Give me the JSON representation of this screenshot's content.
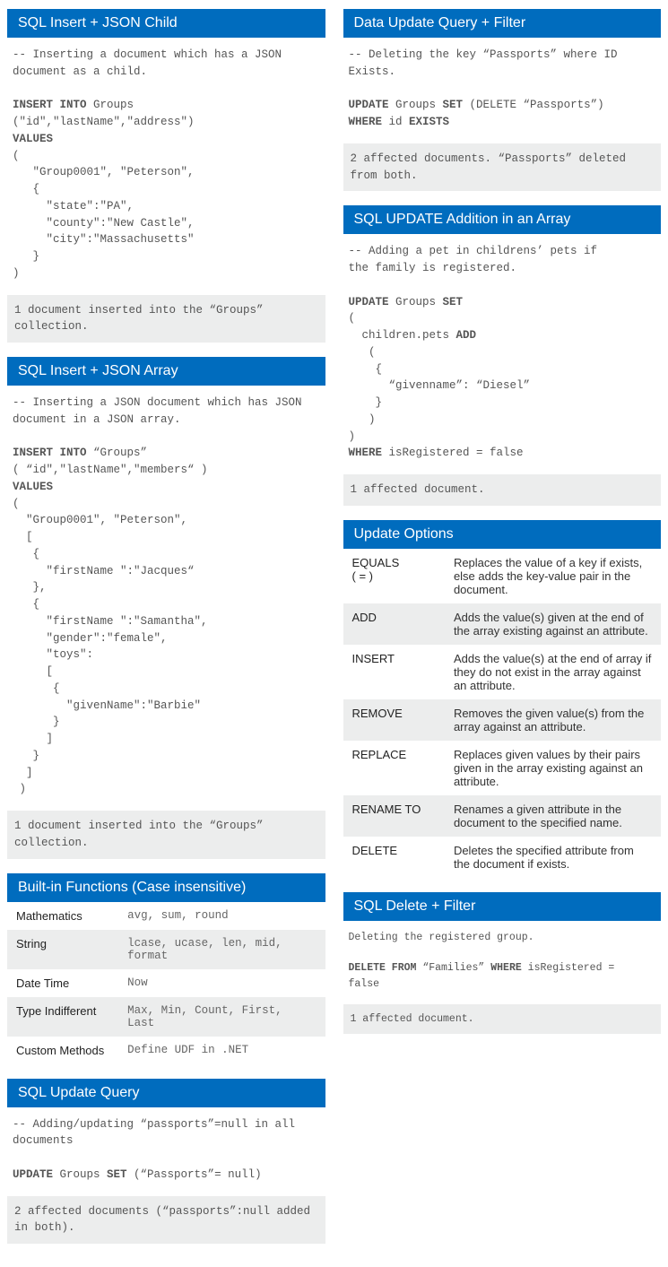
{
  "left": {
    "insert_child": {
      "title": "SQL Insert + JSON Child",
      "code": "-- Inserting a document which has a JSON\ndocument as a child.\n\n<b>INSERT INTO</b> Groups\n(\"id\",\"lastName\",\"address\")\n<b>VALUES</b>\n(\n   \"Group0001\", \"Peterson\",\n   {\n     \"state\":\"PA\",\n     \"county\":\"New Castle\",\n     \"city\":\"Massachusetts\"\n   }\n)",
      "result": "1 document inserted into the “Groups”\ncollection."
    },
    "insert_array": {
      "title": "SQL Insert + JSON Array",
      "code": "-- Inserting a JSON document which has JSON\ndocument in a JSON array.\n\n<b>INSERT INTO</b> “Groups”\n( “id\",\"lastName\",\"members“ )\n<b>VALUES</b>\n(\n  \"Group0001\", \"Peterson\",\n  [\n   {\n     \"firstName \":\"Jacques“\n   },\n   {\n     \"firstName \":\"Samantha\",\n     \"gender\":\"female\",\n     \"toys\":\n     [\n      {\n        \"givenName\":\"Barbie\"\n      }\n     ]\n   }\n  ]\n )",
      "result": "1 document inserted into the “Groups”\ncollection."
    },
    "builtins": {
      "title": "Built-in Functions (Case insensitive)",
      "rows": [
        {
          "label": "Mathematics",
          "value": "avg, sum, round"
        },
        {
          "label": "String",
          "value": "lcase, ucase, len, mid,\nformat"
        },
        {
          "label": "Date Time",
          "value": "Now"
        },
        {
          "label": "Type Indifferent",
          "value": "Max, Min, Count, First,\nLast"
        },
        {
          "label": "Custom Methods",
          "value": "Define UDF in .NET"
        }
      ]
    },
    "update_query": {
      "title": "SQL Update Query",
      "code": "-- Adding/updating “passports”=null in all\ndocuments\n\n<b>UPDATE</b> Groups <b>SET</b> (“Passports”= null)",
      "result": "2 affected documents (“passports”:null added\nin both)."
    }
  },
  "right": {
    "update_filter": {
      "title": "Data Update Query + Filter",
      "code": "-- Deleting the key “Passports” where ID\nExists.\n\n<b>UPDATE</b> Groups <b>SET</b> (DELETE “Passports”)\n<b>WHERE</b> id <b>EXISTS</b>",
      "result": "2 affected documents. “Passports” deleted\nfrom both."
    },
    "update_addition": {
      "title": "SQL UPDATE Addition in an Array",
      "code": "-- Adding a pet in childrens’ pets if\nthe family is registered.\n\n<b>UPDATE</b> Groups <b>SET</b>\n(\n  children.pets <b>ADD</b>\n   (\n    {\n      “givenname”: “Diesel”\n    }\n   )\n)\n<b>WHERE</b> isRegistered = false",
      "result": "1 affected document."
    },
    "update_options": {
      "title": "Update Options",
      "rows": [
        {
          "key": "EQUALS\n( = )",
          "desc": "Replaces the value of a key if exists, else adds the key-value pair in the document."
        },
        {
          "key": "ADD",
          "desc": "Adds the value(s) given at the end of the array existing against an attribute."
        },
        {
          "key": "INSERT",
          "desc": "Adds the value(s) at the end of array if they do not exist in the array against an attribute."
        },
        {
          "key": "REMOVE",
          "desc": "Removes the given value(s) from the array against an attribute."
        },
        {
          "key": "REPLACE",
          "desc": "Replaces given values by their pairs given in the array existing against an attribute."
        },
        {
          "key": "RENAME TO",
          "desc": "Renames a given attribute in the document to the specified name."
        },
        {
          "key": "DELETE",
          "desc": "Deletes the specified attribute from the document if exists."
        }
      ]
    },
    "delete_filter": {
      "title": "SQL Delete + Filter",
      "code": "Deleting the registered group.\n\n<b>DELETE FROM</b> “Families” <b>WHERE</b> isRegistered =\nfalse",
      "result": "1 affected document."
    }
  }
}
